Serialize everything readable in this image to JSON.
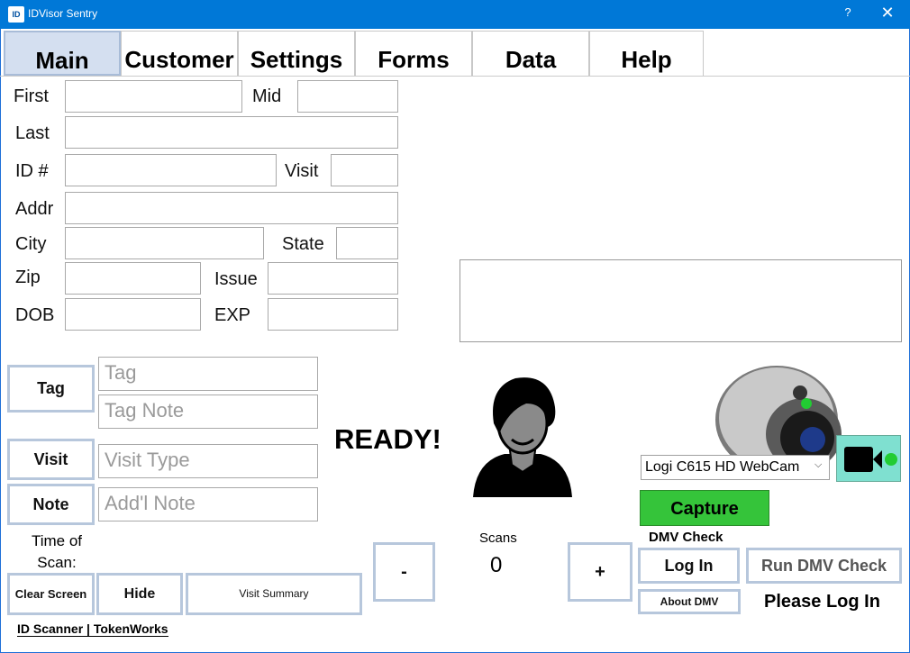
{
  "window": {
    "title": "IDVisor Sentry",
    "help": "?",
    "close": "✕",
    "app_icon_text": "ID"
  },
  "tabs": [
    "Main",
    "Customer",
    "Settings",
    "Forms",
    "Data",
    "Help"
  ],
  "form": {
    "first_label": "First",
    "mid_label": "Mid",
    "last_label": "Last",
    "id_label": "ID #",
    "visit_label": "Visit",
    "addr_label": "Addr",
    "city_label": "City",
    "state_label": "State",
    "zip_label": "Zip",
    "issue_label": "Issue",
    "dob_label": "DOB",
    "exp_label": "EXP"
  },
  "tag_section": {
    "tag_button": "Tag",
    "tag_placeholder": "Tag",
    "tag_note_placeholder": "Tag Note",
    "visit_button": "Visit",
    "visit_type_placeholder": "Visit Type",
    "note_button": "Note",
    "addl_note_placeholder": "Add'l Note"
  },
  "status": "READY!",
  "time_of_scan_label": "Time of Scan:",
  "buttons": {
    "clear_screen": "Clear Screen",
    "hide": "Hide",
    "visit_summary": "Visit Summary",
    "minus": "-",
    "plus": "+"
  },
  "scans": {
    "label": "Scans",
    "value": "0"
  },
  "camera": {
    "selected": "Logi C615 HD WebCam",
    "capture": "Capture",
    "video_icon": "video-camera-icon"
  },
  "dmv": {
    "heading": "DMV Check",
    "log_in": "Log In",
    "run": "Run DMV Check",
    "about": "About DMV",
    "status": "Please Log In"
  },
  "logo": {
    "text": "ID Scanner | TokenWorks"
  },
  "colors": {
    "titlebar": "#0078d7",
    "capture": "#35c43a",
    "video_button": "#7fe0d0"
  }
}
